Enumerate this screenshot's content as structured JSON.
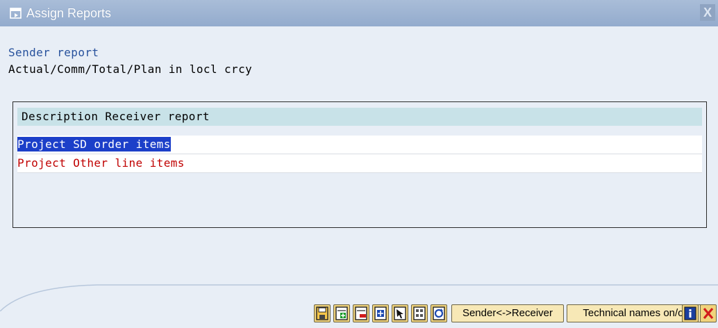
{
  "window": {
    "title": "Assign Reports",
    "title_icon": "window-icon",
    "close_symbol": "X"
  },
  "sender": {
    "label": "Sender report",
    "value": "Actual/Comm/Total/Plan in locl crcy"
  },
  "table": {
    "header": "Description Receiver report",
    "rows": [
      {
        "label": "Project SD order items",
        "selected": true
      },
      {
        "label": "Project Other line items",
        "selected": false
      }
    ]
  },
  "toolbar": {
    "icon_buttons": [
      "save-icon",
      "add-entry-icon",
      "delete-entry-icon",
      "insert-icon",
      "select-icon",
      "layout-icon",
      "refresh-icon"
    ],
    "sender_receiver_label": "Sender<->Receiver",
    "technical_names_label": "Technical names on/off",
    "info_icon": "info-icon",
    "cancel_icon": "cancel-icon"
  },
  "colors": {
    "title_bar": "#93abcd",
    "background": "#e8eef6",
    "header_row": "#c8e2e8",
    "selection": "#1c3fc9",
    "row_text": "#c00000",
    "label_blue": "#27519c"
  }
}
